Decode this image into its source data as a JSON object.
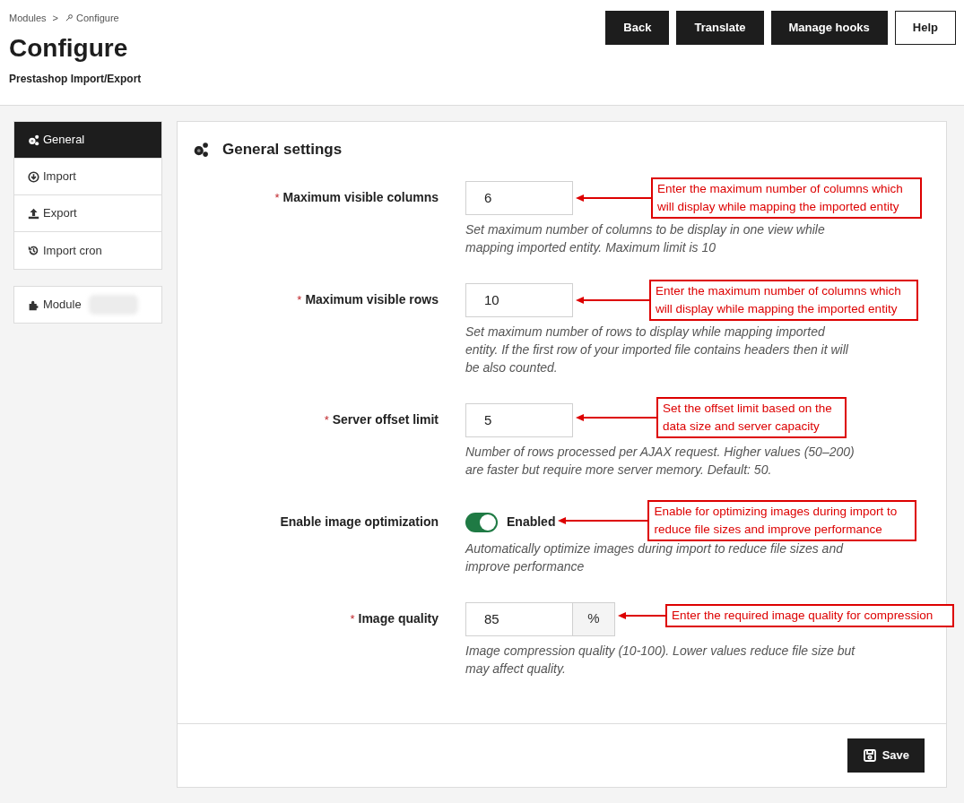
{
  "breadcrumb": [
    {
      "label": "Modules",
      "kind": "link"
    },
    {
      "label": ">",
      "kind": "separator"
    },
    {
      "label": "Configure",
      "kind": "current"
    }
  ],
  "title": "Configure",
  "subtitle": "Prestashop Import/Export",
  "toolbar": [
    {
      "label": "Back",
      "kind": "dark"
    },
    {
      "label": "Translate",
      "kind": "dark"
    },
    {
      "label": "Manage hooks",
      "kind": "dark"
    },
    {
      "label": "Help",
      "kind": "light"
    }
  ],
  "sidebar": {
    "items": [
      {
        "label": "General",
        "selected": true
      },
      {
        "label": "Import",
        "selected": false
      },
      {
        "label": "Export",
        "selected": false
      },
      {
        "label": "Import cron",
        "selected": false
      }
    ],
    "module_item": {
      "label": "Module",
      "redacted": true
    }
  },
  "panel": {
    "title": "General settings",
    "fields": [
      {
        "kind": "text",
        "label": "Maximum visible columns",
        "required": true,
        "value": "6",
        "help": "Set maximum number of columns to be display in one view while mapping imported entity. Maximum limit is 10",
        "annotation": "Enter the maximum number of columns which will display while mapping the imported entity"
      },
      {
        "kind": "text",
        "label": "Maximum visible rows",
        "required": true,
        "value": "10",
        "help": "Set maximum number of rows to display while mapping imported entity. If the first row of your imported file contains headers then it will be also counted.",
        "annotation": "Enter the maximum number of columns which will display while mapping the imported entity"
      },
      {
        "kind": "text",
        "label": "Server offset limit",
        "required": true,
        "value": "5",
        "help": "Number of rows processed per AJAX request. Higher values (50–200) are faster but require more server memory. Default: 50.",
        "annotation": "Set the offset limit based on the data size and server capacity"
      },
      {
        "kind": "toggle",
        "label": "Enable image optimization",
        "required": false,
        "on": true,
        "state_label": "Enabled",
        "help": "Automatically optimize images during import to reduce file sizes and improve performance",
        "annotation": "Enable for optimizing images during import to reduce file sizes and improve performance"
      },
      {
        "kind": "addon",
        "label": "Image quality",
        "required": true,
        "value": "85",
        "addon": "%",
        "help": "Image compression quality (10-100). Lower values reduce file size but may affect quality.",
        "annotation": "Enter the required image quality for compression"
      }
    ],
    "required_mark": "*",
    "save_label": "Save"
  }
}
